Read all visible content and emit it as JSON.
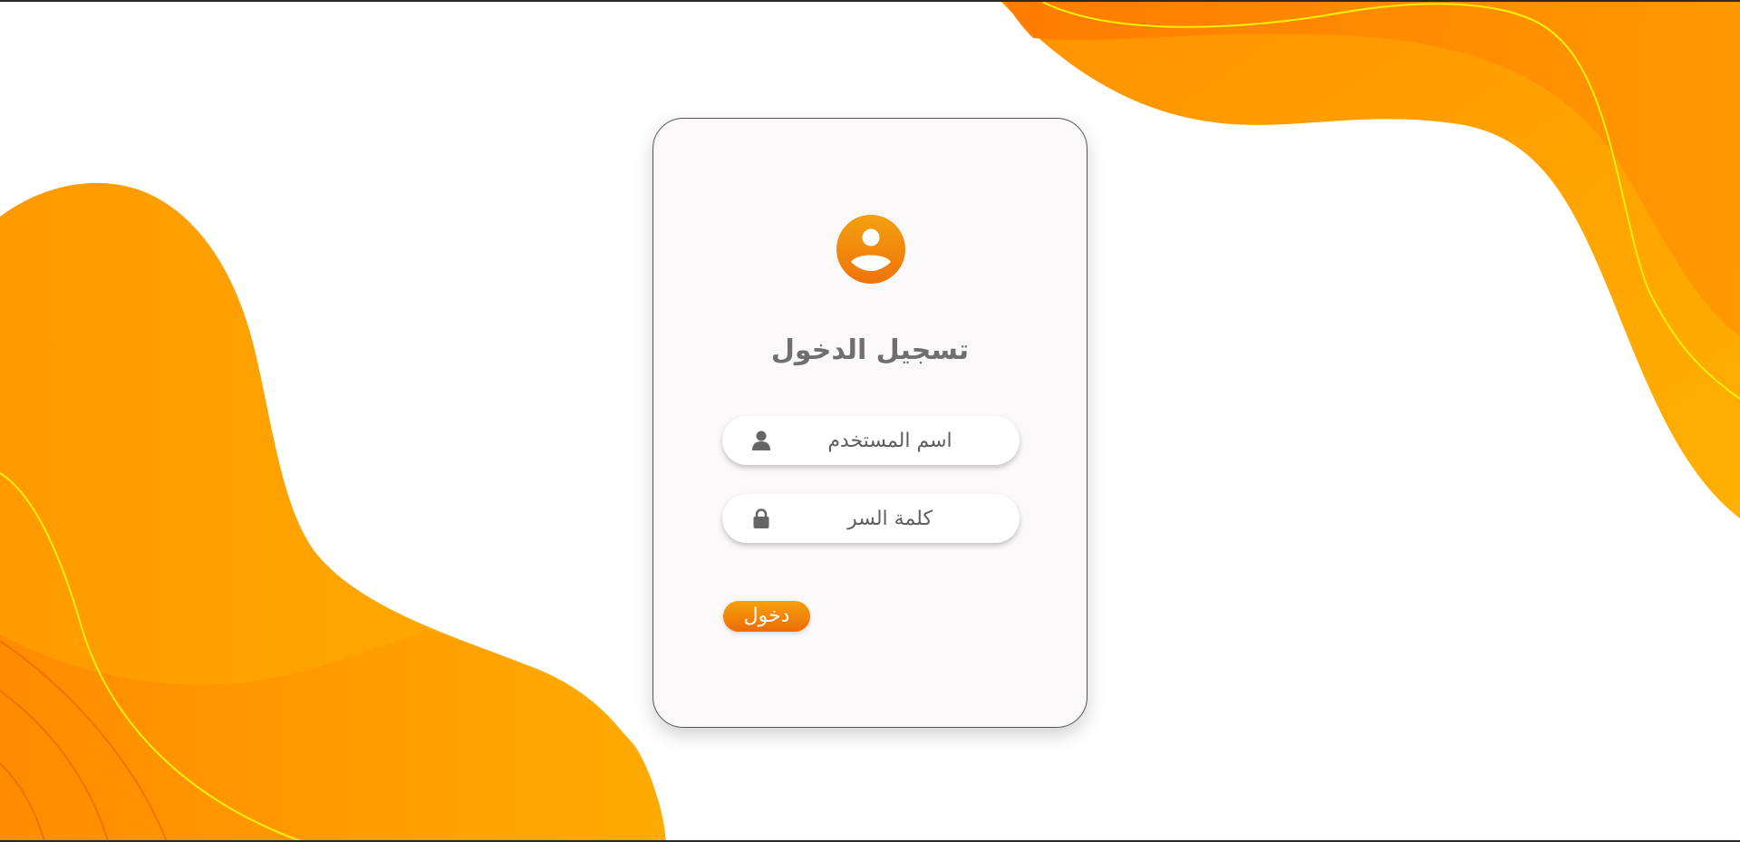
{
  "colors": {
    "accent": "#f28a0c",
    "accent_dark": "#ec6c07",
    "wave_orange": "#ffa000",
    "wave_line": "#f5f000",
    "card_background": "#faf8f8",
    "text_gray": "#6f6f6f"
  },
  "login": {
    "avatar_icon": "user-circle-icon",
    "title": "تسجيل الدخول",
    "username": {
      "placeholder": "اسم المستخدم",
      "value": "",
      "icon": "user-icon"
    },
    "password": {
      "placeholder": "كلمة السر",
      "value": "",
      "icon": "lock-icon"
    },
    "submit_label": "دخول"
  }
}
